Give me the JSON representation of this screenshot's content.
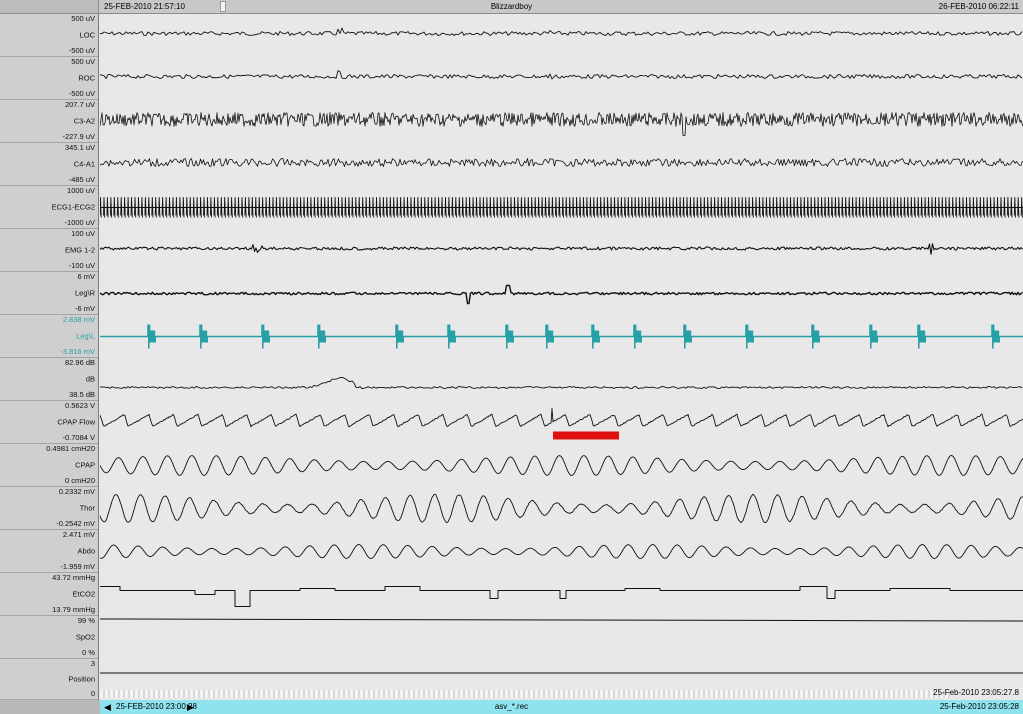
{
  "header": {
    "start_time": "25-FEB-2010 21:57:10",
    "title": "Blizzardboy",
    "end_time": "26-FEB-2010 06:22:11"
  },
  "channels": [
    {
      "name": "LOC",
      "max": "500 uV",
      "min": "-500 uV",
      "color": "#111111",
      "style": "eeg_small"
    },
    {
      "name": "ROC",
      "max": "500 uV",
      "min": "-500 uV",
      "color": "#111111",
      "style": "eeg_small"
    },
    {
      "name": "C3-A2",
      "max": "207.7 uV",
      "min": "-227.9 uV",
      "color": "#111111",
      "style": "eeg_dense"
    },
    {
      "name": "C4-A1",
      "max": "345.1 uV",
      "min": "-485 uV",
      "color": "#111111",
      "style": "eeg_medium"
    },
    {
      "name": "ECG1-ECG2",
      "max": "1000 uV",
      "min": "-1000 uV",
      "color": "#111111",
      "style": "ecg"
    },
    {
      "name": "EMG 1-2",
      "max": "100 uV",
      "min": "-100 uV",
      "color": "#111111",
      "style": "emg"
    },
    {
      "name": "Leg\\R",
      "max": "6 mV",
      "min": "-6 mV",
      "color": "#111111",
      "style": "leg"
    },
    {
      "name": "Leg\\L",
      "max": "2.838 mV",
      "min": "-3.816 mV",
      "color": "#28a0a8",
      "style": "legl"
    },
    {
      "name": "dB",
      "max": "82.96 dB",
      "min": "38.5 dB",
      "color": "#111111",
      "style": "snore"
    },
    {
      "name": "CPAP Flow",
      "max": "0.5623 V",
      "min": "-0.7084 V",
      "color": "#111111",
      "style": "flow"
    },
    {
      "name": "CPAP",
      "max": "0.4981 cmH20",
      "min": "0 cmH20",
      "color": "#111111",
      "style": "cpap"
    },
    {
      "name": "Thor",
      "max": "0.2332 mV",
      "min": "-0.2542 mV",
      "color": "#111111",
      "style": "thor"
    },
    {
      "name": "Abdo",
      "max": "2.471 mV",
      "min": "-1.959 mV",
      "color": "#111111",
      "style": "abdo"
    },
    {
      "name": "EtCO2",
      "max": "43.72 mmHg",
      "min": "13.79 mmHg",
      "color": "#111111",
      "style": "etco2"
    },
    {
      "name": "SpO2",
      "max": "99 %",
      "min": "0 %",
      "color": "#111111",
      "style": "spo2"
    },
    {
      "name": "Position",
      "max": "3",
      "min": "0",
      "color": "#111111",
      "style": "position"
    }
  ],
  "event_marker_color": "#e01010",
  "footer": {
    "cursor_time": "25-Feb-2010 23:05:27.8",
    "window_start": "25-FEB-2010 23:00:28",
    "filename": "asv_*.rec",
    "window_end": "25-Feb-2010 23:05:28",
    "left_arrow": "◀",
    "right_arrow": "▶"
  }
}
